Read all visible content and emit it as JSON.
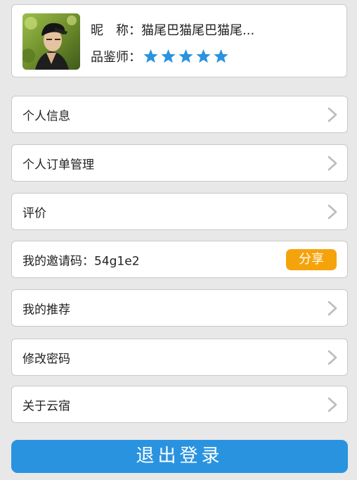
{
  "profile": {
    "nickname_label": "昵　称：",
    "nickname_value": "猫尾巴猫尾巴猫尾...",
    "rating_label": "品鉴师：",
    "rating_stars": 5,
    "rating_max": 5
  },
  "menu": {
    "personal_info": "个人信息",
    "order_management": "个人订单管理",
    "review": "评价",
    "invite_code_label": "我的邀请码：",
    "invite_code_value": "54g1e2",
    "share_label": "分享",
    "my_referrals": "我的推荐",
    "change_password": "修改密码",
    "about": "关于云宿"
  },
  "logout_label": "退出登录",
  "colors": {
    "background": "#e8e8e8",
    "star": "#2a93e0",
    "share_button": "#f5a30b",
    "logout_button": "#2a93e0",
    "chevron": "#bcbcbc"
  }
}
